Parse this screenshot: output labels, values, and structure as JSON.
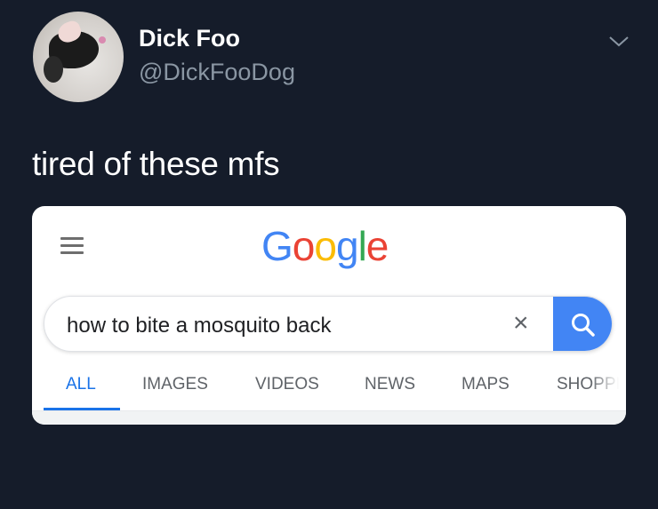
{
  "tweet": {
    "display_name": "Dick Foo",
    "handle": "@DickFooDog",
    "text": "tired of these mfs"
  },
  "google_card": {
    "logo_letters": [
      {
        "ch": "G",
        "color": "#4285f4"
      },
      {
        "ch": "o",
        "color": "#ea4335"
      },
      {
        "ch": "o",
        "color": "#fbbc05"
      },
      {
        "ch": "g",
        "color": "#4285f4"
      },
      {
        "ch": "l",
        "color": "#34a853"
      },
      {
        "ch": "e",
        "color": "#ea4335"
      }
    ],
    "search": {
      "query": "how to bite a mosquito back",
      "clear_glyph": "×"
    },
    "tabs": [
      "ALL",
      "IMAGES",
      "VIDEOS",
      "NEWS",
      "MAPS",
      "SHOPPI"
    ],
    "active_tab": "ALL",
    "accent_color": "#1a73e8"
  },
  "icons": {
    "menu": "hamburger-icon",
    "search": "search-icon",
    "clear": "close-icon",
    "more": "chevron-down-icon"
  }
}
